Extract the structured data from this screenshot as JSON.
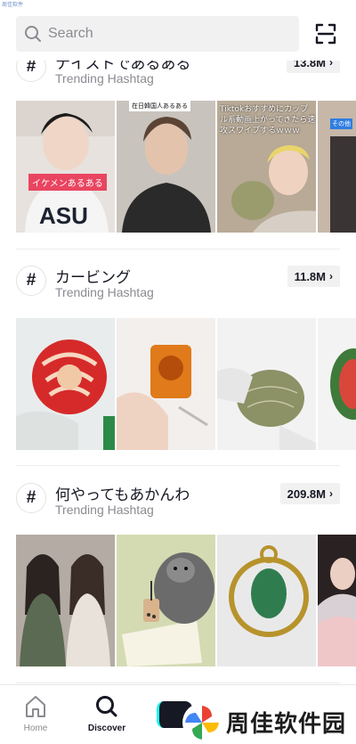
{
  "watermark_top": "周佳软件",
  "search": {
    "placeholder": "Search"
  },
  "sections": [
    {
      "title": "ナイストであるある",
      "subtitle": "Trending Hashtag",
      "count": "13.8M",
      "captions": [
        "イケメンあるある",
        "在日韓国人あるある",
        "Tiktokおすすめにカップル系動画上がってきたら速攻スワイプするｗｗｗ",
        "その他"
      ]
    },
    {
      "title": "カービング",
      "subtitle": "Trending Hashtag",
      "count": "11.8M"
    },
    {
      "title": "何やってもあかんわ",
      "subtitle": "Trending Hashtag",
      "count": "209.8M"
    }
  ],
  "tabbar": {
    "home": "Home",
    "discover": "Discover"
  },
  "watermark_logo": "周佳软件园",
  "colors": {
    "text": "#161823",
    "muted": "#8a8b91",
    "badge_bg": "#f1f1f2",
    "search_bg": "#f1f1f2"
  }
}
